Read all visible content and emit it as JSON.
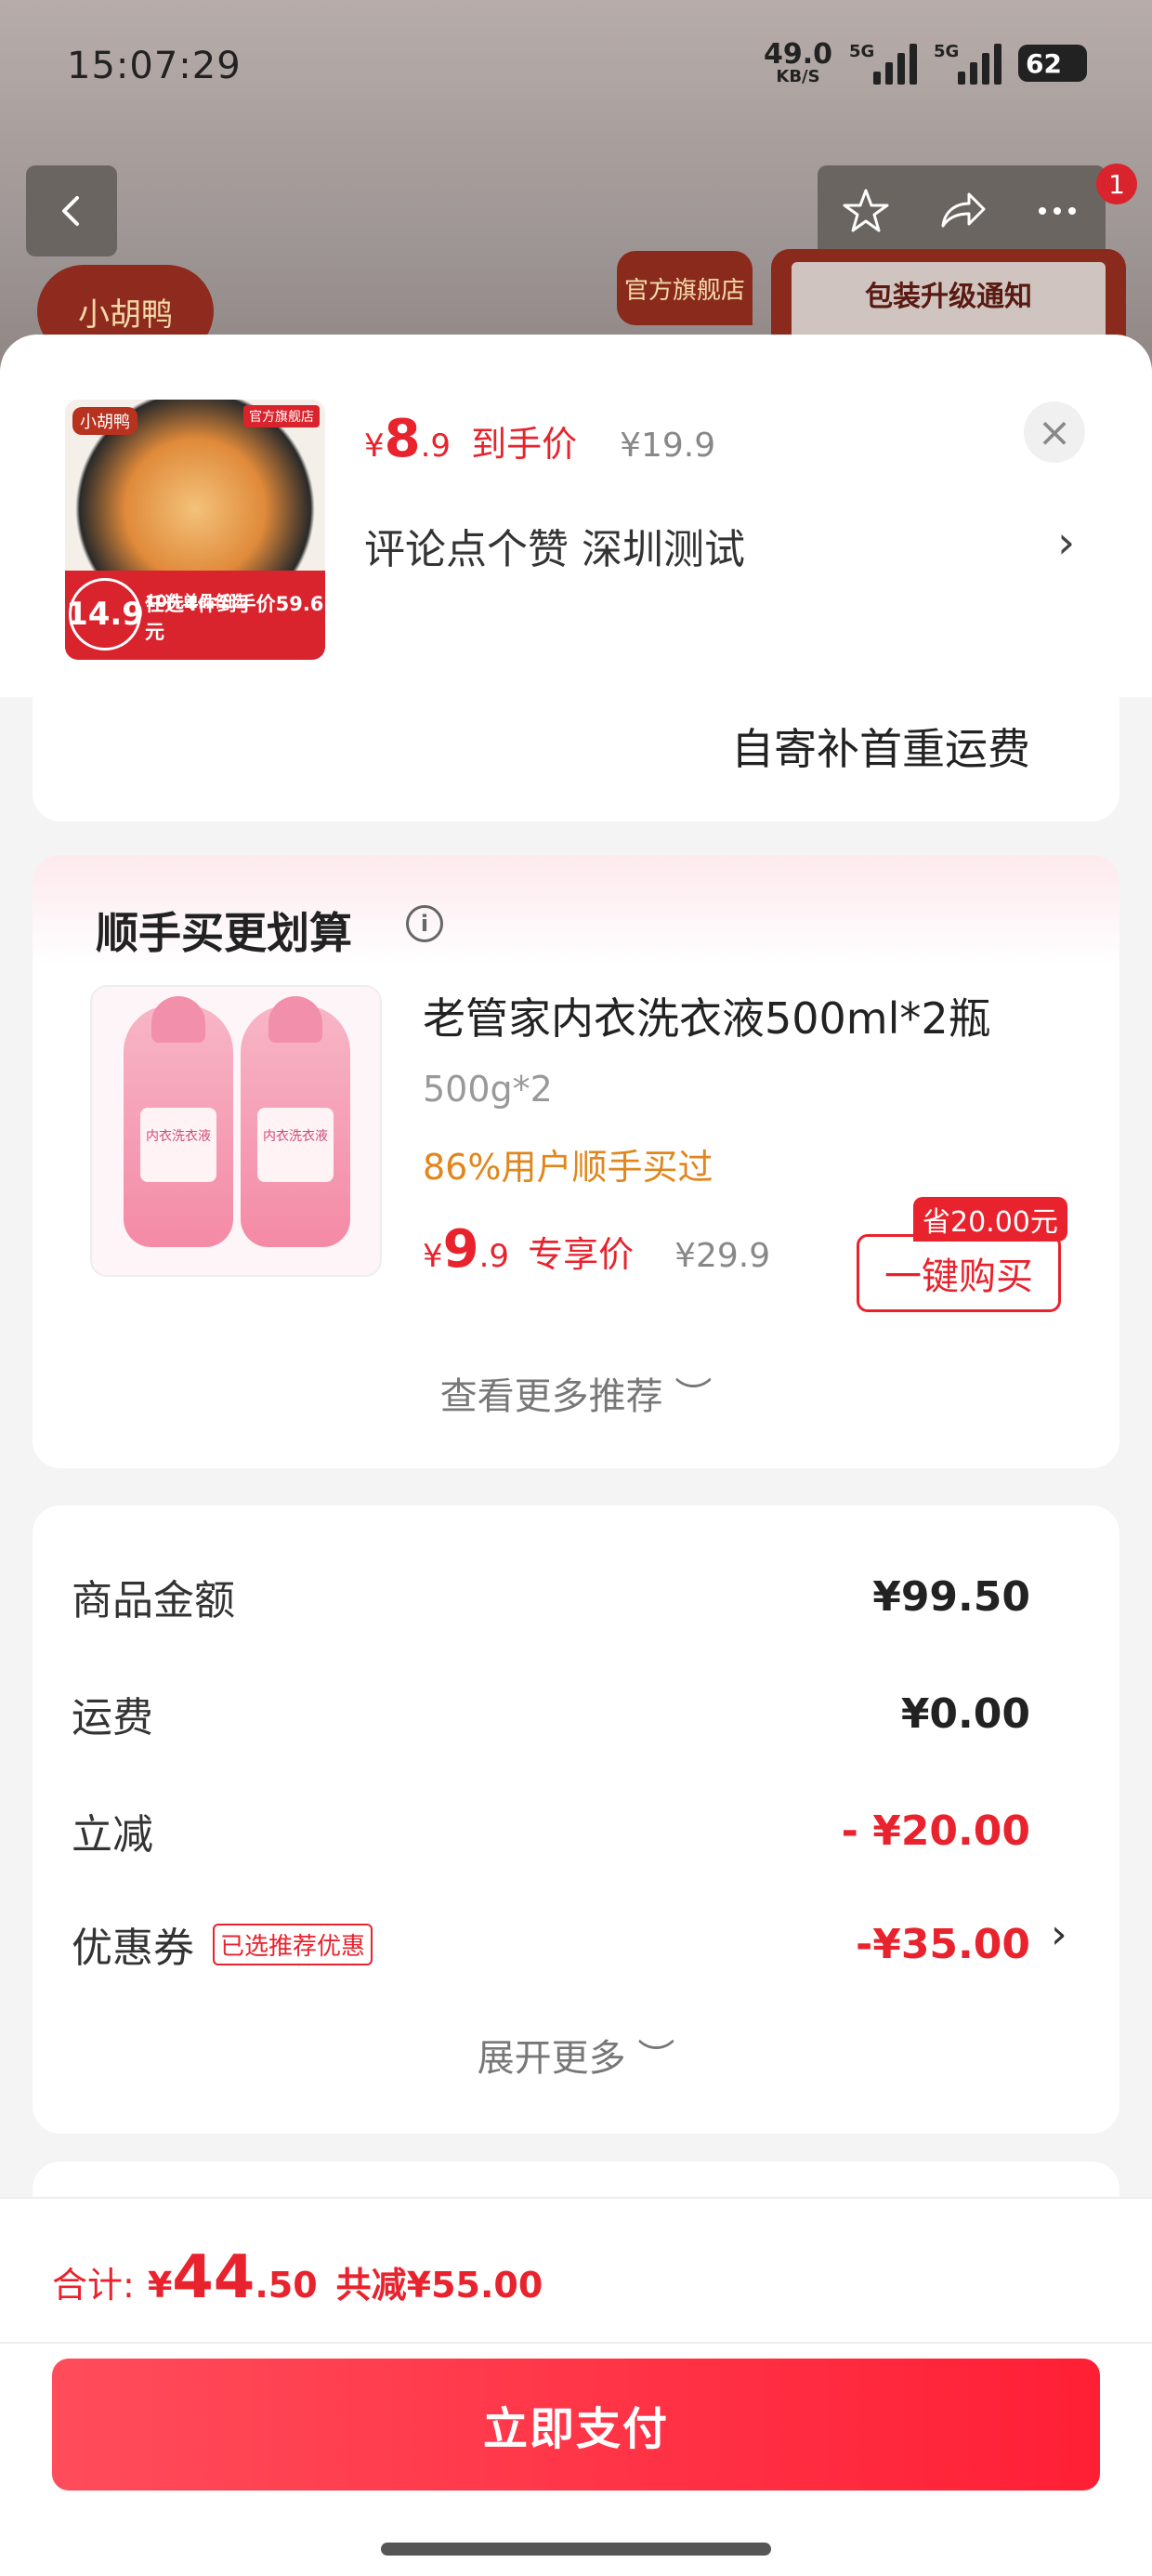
{
  "status_bar": {
    "time": "15:07:29",
    "net_speed": "49.0",
    "net_unit": "KB/S",
    "signal1": "5G",
    "signal2": "5G",
    "battery": "62"
  },
  "background": {
    "nav_badge": "1",
    "logo_text": "小胡鸭",
    "flagship_label": "官方旗舰店",
    "notice_title": "包装升级通知"
  },
  "product": {
    "price_symbol": "¥",
    "price_int": "8",
    "price_dec": ".9",
    "price_label": "到手价",
    "original_price": "¥19.9",
    "name": "评论点个赞  深圳测试",
    "thumb_logo": "小胡鸭",
    "thumb_flag": "官方旗舰店",
    "thumb_price": "14.9",
    "thumb_line1": "10件单品任选",
    "thumb_line2": "任选4件到手价59.6元"
  },
  "shipping": {
    "text": "自寄补首重运费"
  },
  "upsell": {
    "title": "顺手买更划算",
    "info_icon": "i",
    "item_name": "老管家内衣洗衣液500ml*2瓶",
    "spec": "500g*2",
    "buy_rate": "86%用户顺手买过",
    "price_symbol": "¥",
    "price_int": "9",
    "price_dec": ".9",
    "price_label": "专享价",
    "original_price": "¥29.9",
    "save_tag": "省20.00元",
    "buy_button": "一键购买",
    "more_recommend": "查看更多推荐 ︶",
    "bottle_label": "内衣洗衣液"
  },
  "summary": {
    "rows": [
      {
        "label": "商品金额",
        "value": "¥99.50"
      },
      {
        "label": "运费",
        "value": "¥0.00"
      },
      {
        "label": "立减",
        "value": "- ¥20.00"
      },
      {
        "label": "优惠券",
        "value": "-¥35.00",
        "tag": "已选推荐优惠"
      }
    ],
    "expand": "展开更多 ︶"
  },
  "footer": {
    "total_label": "合计:",
    "total_symbol": "¥",
    "total_int": "44",
    "total_dec": ".50",
    "total_saved": "共减¥55.00",
    "pay_button": "立即支付"
  },
  "colors": {
    "accent": "#e8232d",
    "orange": "#e0861c",
    "pay_button": "#ff1f35"
  }
}
